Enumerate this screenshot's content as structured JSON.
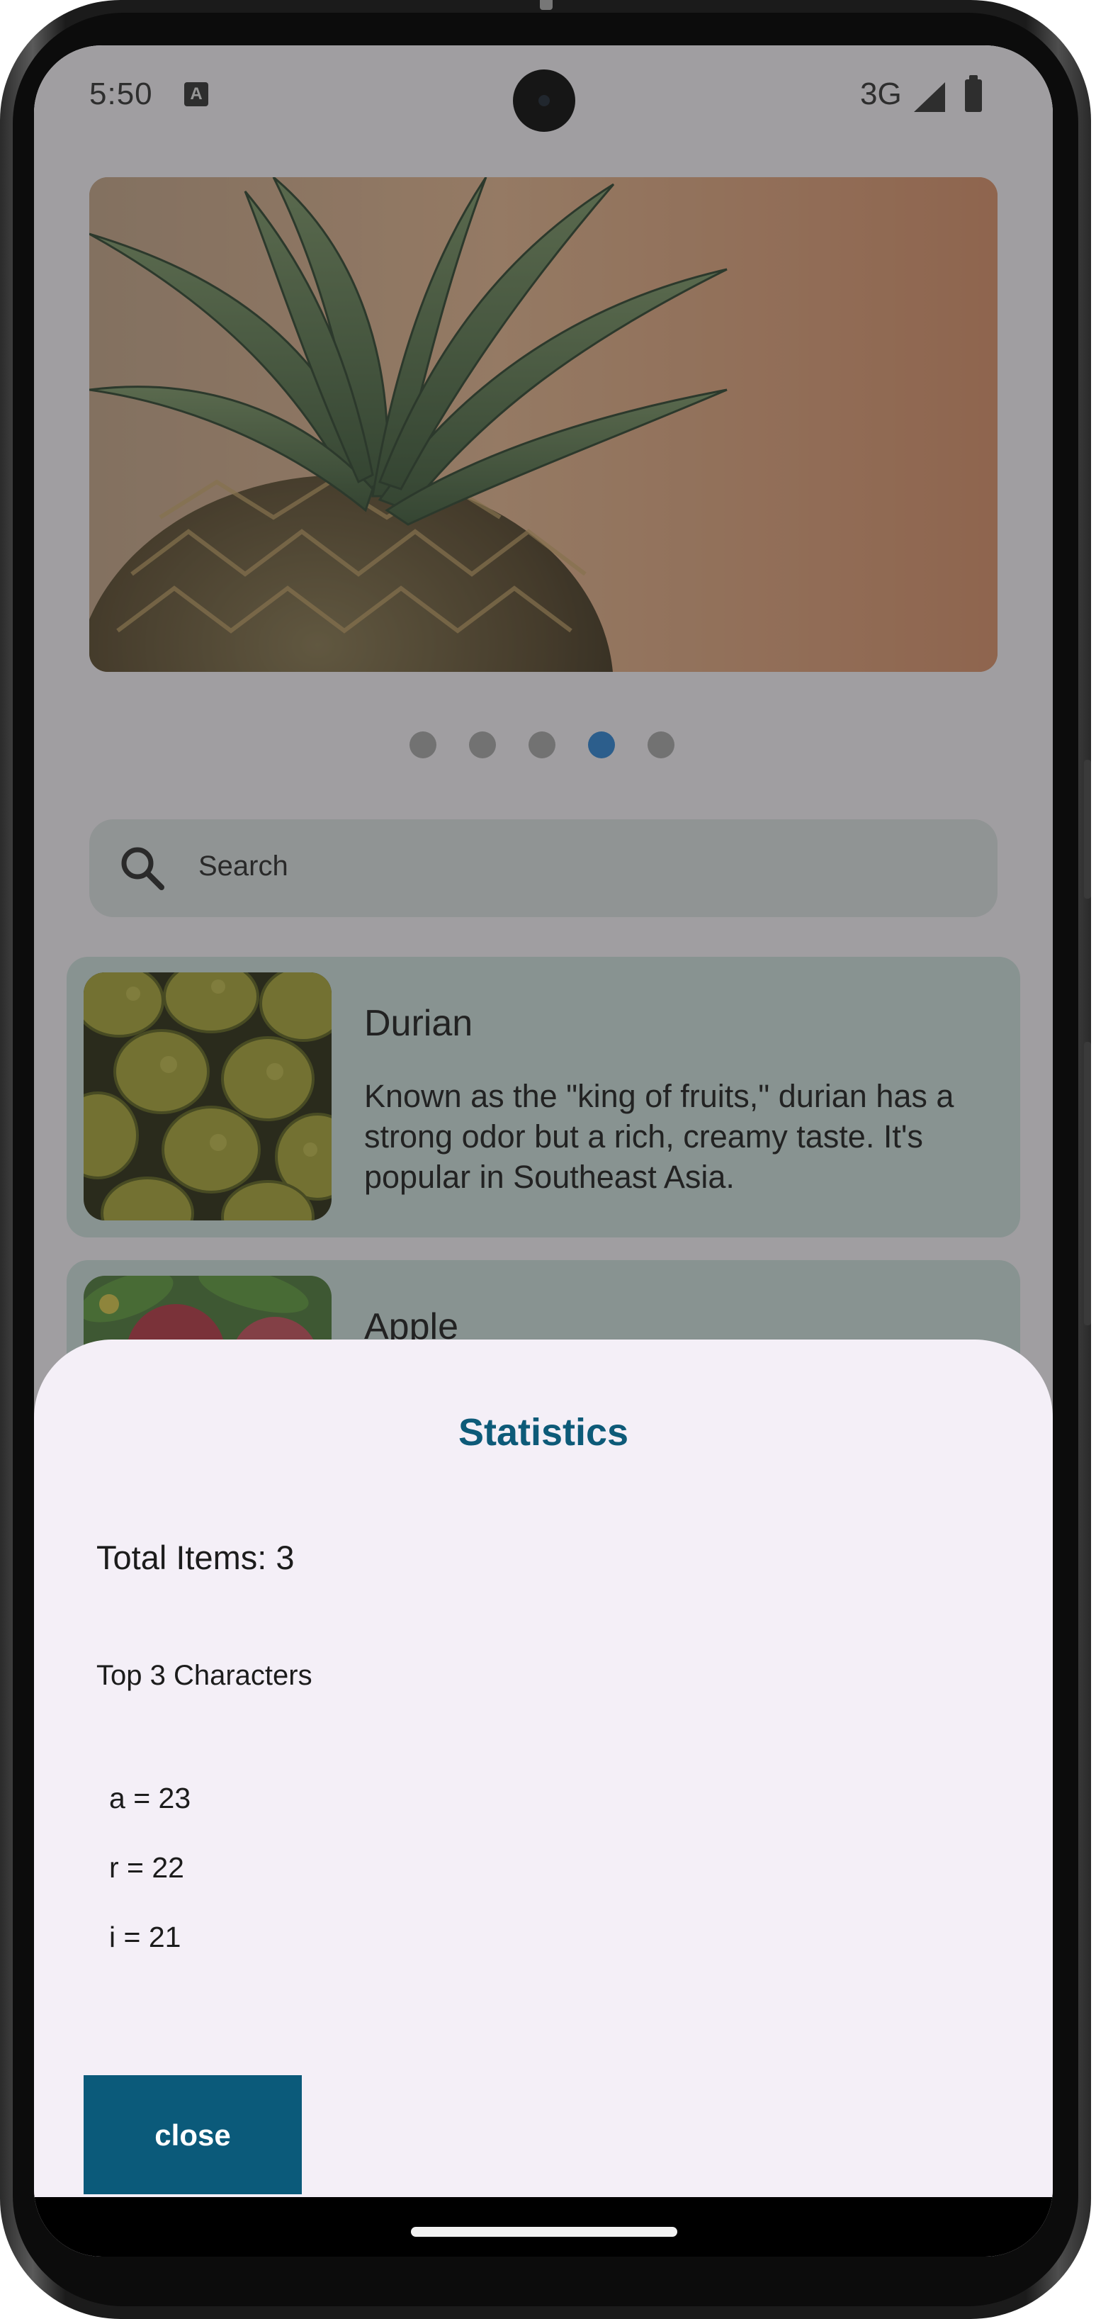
{
  "status_bar": {
    "time": "5:50",
    "network": "3G",
    "icons": [
      "text-a-icon",
      "signal-icon",
      "battery-icon"
    ]
  },
  "carousel": {
    "image": "pineapple-photo",
    "page_count": 5,
    "active_index": 3,
    "colors": {
      "active_dot": "#2f85d4",
      "inactive_dot": "#a8a8a8"
    }
  },
  "search": {
    "placeholder": "Search"
  },
  "list": {
    "items": [
      {
        "title": "Durian",
        "description": "Known as the \"king of fruits,\" durian has a strong odor but a rich, creamy taste. It's popular in Southeast Asia.",
        "image": "durian-photo"
      },
      {
        "title": "Apple",
        "description": "",
        "image": "apple-photo"
      }
    ]
  },
  "statistics_sheet": {
    "title": "Statistics",
    "total_items": "Total Items: 3",
    "top_chars_label": "Top 3 Characters",
    "top_chars": [
      "a = 23",
      "r = 22",
      "i = 21"
    ],
    "close_label": "close",
    "colors": {
      "title": "#0d5a78",
      "button": "#0b5a7a",
      "sheet_bg": "#f4eff7"
    }
  }
}
